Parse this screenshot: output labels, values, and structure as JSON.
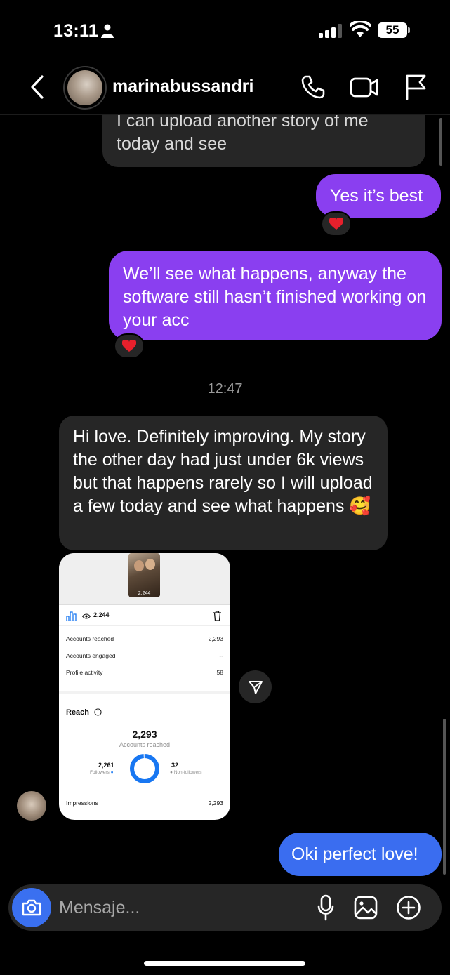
{
  "status_bar": {
    "time": "13:11",
    "battery": "55"
  },
  "header": {
    "contact_name": "marinabussandri"
  },
  "messages": [
    {
      "text": "I can upload another story of me today and see",
      "direction": "incoming"
    },
    {
      "text": "Yes it’s best",
      "direction": "outgoing",
      "reaction": "red-heart"
    },
    {
      "text": "We’ll see what happens, anyway the software still hasn’t finished working on your acc",
      "direction": "outgoing",
      "reaction": "red-heart"
    },
    {
      "text": "Hi love. Definitely improving. My story the other day had just under 6k views but that happens rarely so I will upload a few today and see what happens 🥰",
      "direction": "incoming"
    },
    {
      "text": "Oki perfect love!",
      "direction": "outgoing"
    }
  ],
  "timestamp": "12:47",
  "shared_screenshot": {
    "thumb_views": "2,244",
    "views": "2,244",
    "rows": [
      {
        "label": "Accounts reached",
        "value": "2,293"
      },
      {
        "label": "Accounts engaged",
        "value": "--"
      },
      {
        "label": "Profile activity",
        "value": "58"
      }
    ],
    "reach_title": "Reach",
    "reach_number": "2,293",
    "reach_label": "Accounts reached",
    "followers_value": "2,261",
    "followers_label": "Followers",
    "nonfollowers_value": "32",
    "nonfollowers_label": "Non-followers",
    "followers_fraction": 0.986,
    "impressions_label": "Impressions",
    "impressions_value": "2,293"
  },
  "composer": {
    "placeholder": "Mensaje..."
  },
  "colors": {
    "outgoing_purple": "#8a3ff0",
    "outgoing_blue": "#3a6df0",
    "incoming_gray": "#262626",
    "camera_blue": "#3a70f0"
  }
}
